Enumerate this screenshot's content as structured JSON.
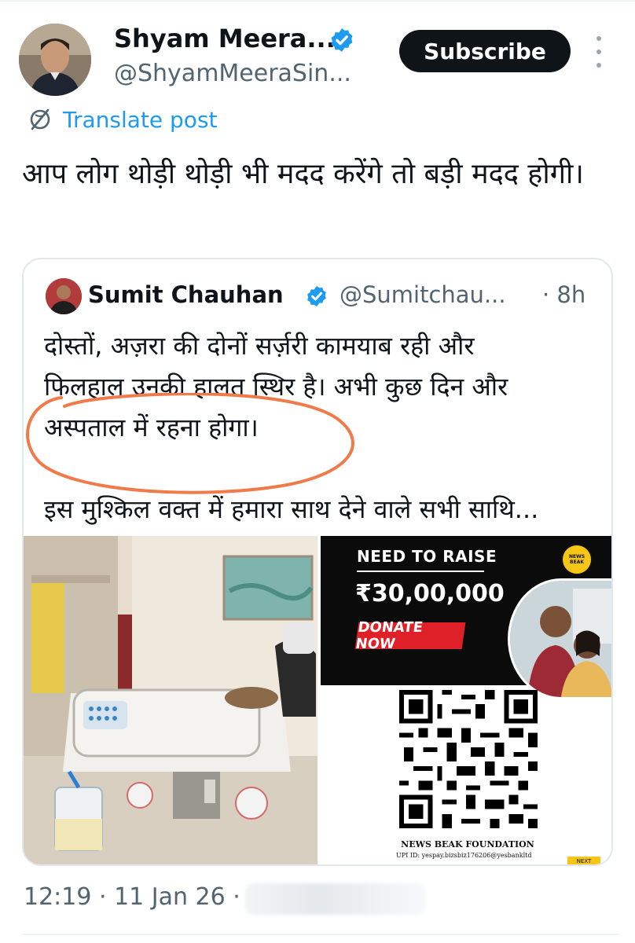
{
  "post": {
    "author": {
      "name": "Shyam Meera...",
      "handle": "@ShyamMeeraSin..."
    },
    "subscribe_label": "Subscribe",
    "translate_label": "Translate post",
    "text": "आप लोग थोड़ी थोड़ी भी मदद करेंगे तो बड़ी मदद होगी।",
    "timestamp": "12:19 · 11 Jan 26 ·"
  },
  "quote": {
    "author": {
      "name": "Sumit Chauhan",
      "handle": "@Sumitchau...",
      "time": "· 8h"
    },
    "lines": [
      "दोस्तों, अज़रा की दोनों सर्ज़री कामयाब रही और",
      "फिलहाल उनकी हालत स्थिर है। अभी कुछ दिन और",
      "अस्पताल में रहना होगा।",
      "इस मुश्किल वक्त में हमारा साथ देने वाले सभी साथि..."
    ],
    "poster": {
      "heading": "NEED TO RAISE",
      "amount": "₹30,00,000",
      "donate_label": "DONATE NOW",
      "logo_line1": "NEWS",
      "logo_line2": "BEAK",
      "foundation": "NEWS BEAK FOUNDATION",
      "upi": "UPI ID:  yespay.bizsbiz176206@yesbankltd",
      "next": "NEXT"
    }
  },
  "colors": {
    "accent_blue": "#1d9bf0",
    "text_primary": "#0f1419",
    "text_secondary": "#536471",
    "annotation_circle": "#f07a4a",
    "donate_red": "#e02028"
  },
  "icons": {
    "verified": "verified-badge-icon",
    "translate": "globe-icon",
    "more": "more-vertical-icon"
  }
}
